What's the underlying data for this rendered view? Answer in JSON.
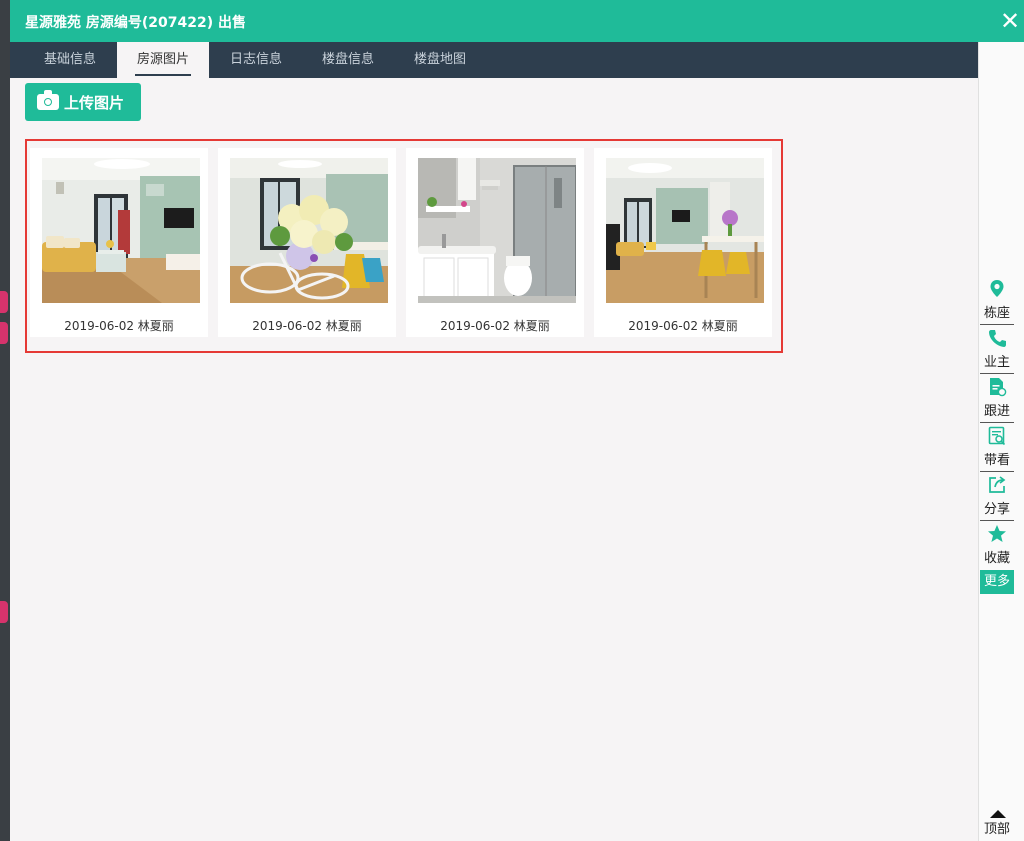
{
  "window": {
    "title": "星源雅苑 房源编号(207422) 出售",
    "close_glyph": "✕"
  },
  "tabs": [
    {
      "label": "基础信息",
      "active": false
    },
    {
      "label": "房源图片",
      "active": true
    },
    {
      "label": "日志信息",
      "active": false
    },
    {
      "label": "楼盘信息",
      "active": false
    },
    {
      "label": "楼盘地图",
      "active": false
    }
  ],
  "upload_button": {
    "label": "上传图片",
    "icon": "camera-icon"
  },
  "photos": [
    {
      "caption": "2019-06-02 林夏丽",
      "subject": "living-room"
    },
    {
      "caption": "2019-06-02 林夏丽",
      "subject": "flower-arrangement"
    },
    {
      "caption": "2019-06-02 林夏丽",
      "subject": "bathroom"
    },
    {
      "caption": "2019-06-02 林夏丽",
      "subject": "dining-area"
    }
  ],
  "side_actions": [
    {
      "label": "栋座",
      "icon": "location-pin-icon"
    },
    {
      "label": "业主",
      "icon": "phone-icon"
    },
    {
      "label": "跟进",
      "icon": "document-edit-icon"
    },
    {
      "label": "带看",
      "icon": "document-search-icon"
    },
    {
      "label": "分享",
      "icon": "share-icon"
    },
    {
      "label": "收藏",
      "icon": "star-icon"
    }
  ],
  "more_label": "更多",
  "back_to_top_label": "顶部",
  "colors": {
    "accent": "#1fbb99",
    "tabbar": "#2e3e4e",
    "highlight": "#e53935"
  }
}
